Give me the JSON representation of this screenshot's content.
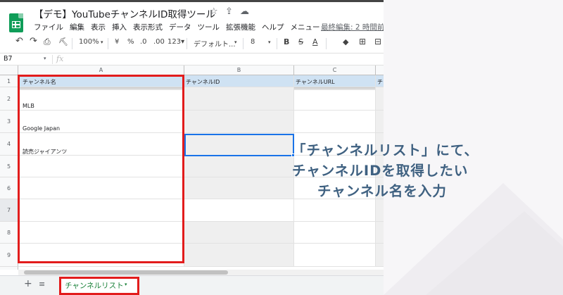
{
  "app": {
    "title": "【デモ】YouTubeチャンネルID取得ツール",
    "star_icon": "☆",
    "move_icon": "⇪",
    "cloud_icon": "☁"
  },
  "menu": {
    "items": [
      "ファイル",
      "編集",
      "表示",
      "挿入",
      "表示形式",
      "データ",
      "ツール",
      "拡張機能",
      "ヘルプ",
      "メニュー"
    ],
    "last_edit": "最終編集: 2 時間前"
  },
  "toolbar": {
    "undo": "↶",
    "redo": "↷",
    "print": "⎙",
    "paint": "⛏",
    "zoom": "100%",
    "currency": "¥",
    "percent": "%",
    "dec_decrease": ".0",
    "dec_increase": ".00",
    "format_more": "123▾",
    "font": "デフォルト...",
    "font_size": "8",
    "bold": "B",
    "strike": "S",
    "text_color": "A",
    "fill_icon": "◆",
    "borders_icon": "⊞",
    "merge_icon": "⊟",
    "caret": "▾"
  },
  "formula_bar": {
    "cell_ref": "B7",
    "fx": "fx",
    "caret": "▾"
  },
  "grid": {
    "columns": [
      "A",
      "B",
      "C"
    ],
    "rows": [
      "1",
      "2",
      "3",
      "4",
      "5",
      "6",
      "7",
      "8",
      "9"
    ],
    "header_cells": {
      "a": "チャンネル名",
      "b": "チャンネルID",
      "c": "チャンネルURL",
      "d": "チ"
    },
    "values": [
      "MLB",
      "Google Japan",
      "読売ジャイアンツ"
    ]
  },
  "sheets": {
    "add": "+",
    "all": "≡",
    "active_tab": "チャンネルリスト",
    "caret": "▾"
  },
  "callout": {
    "line1": "「チャンネルリスト」にて、",
    "line2": "チャンネルIDを取得したい",
    "line3": "チャンネル名を入力"
  },
  "colors": {
    "highlight": "#e21c1c",
    "header_fill": "#cfe2f3",
    "selection": "#1a73e8",
    "sheets_green": "#188038",
    "callout_text": "#3f6181"
  }
}
